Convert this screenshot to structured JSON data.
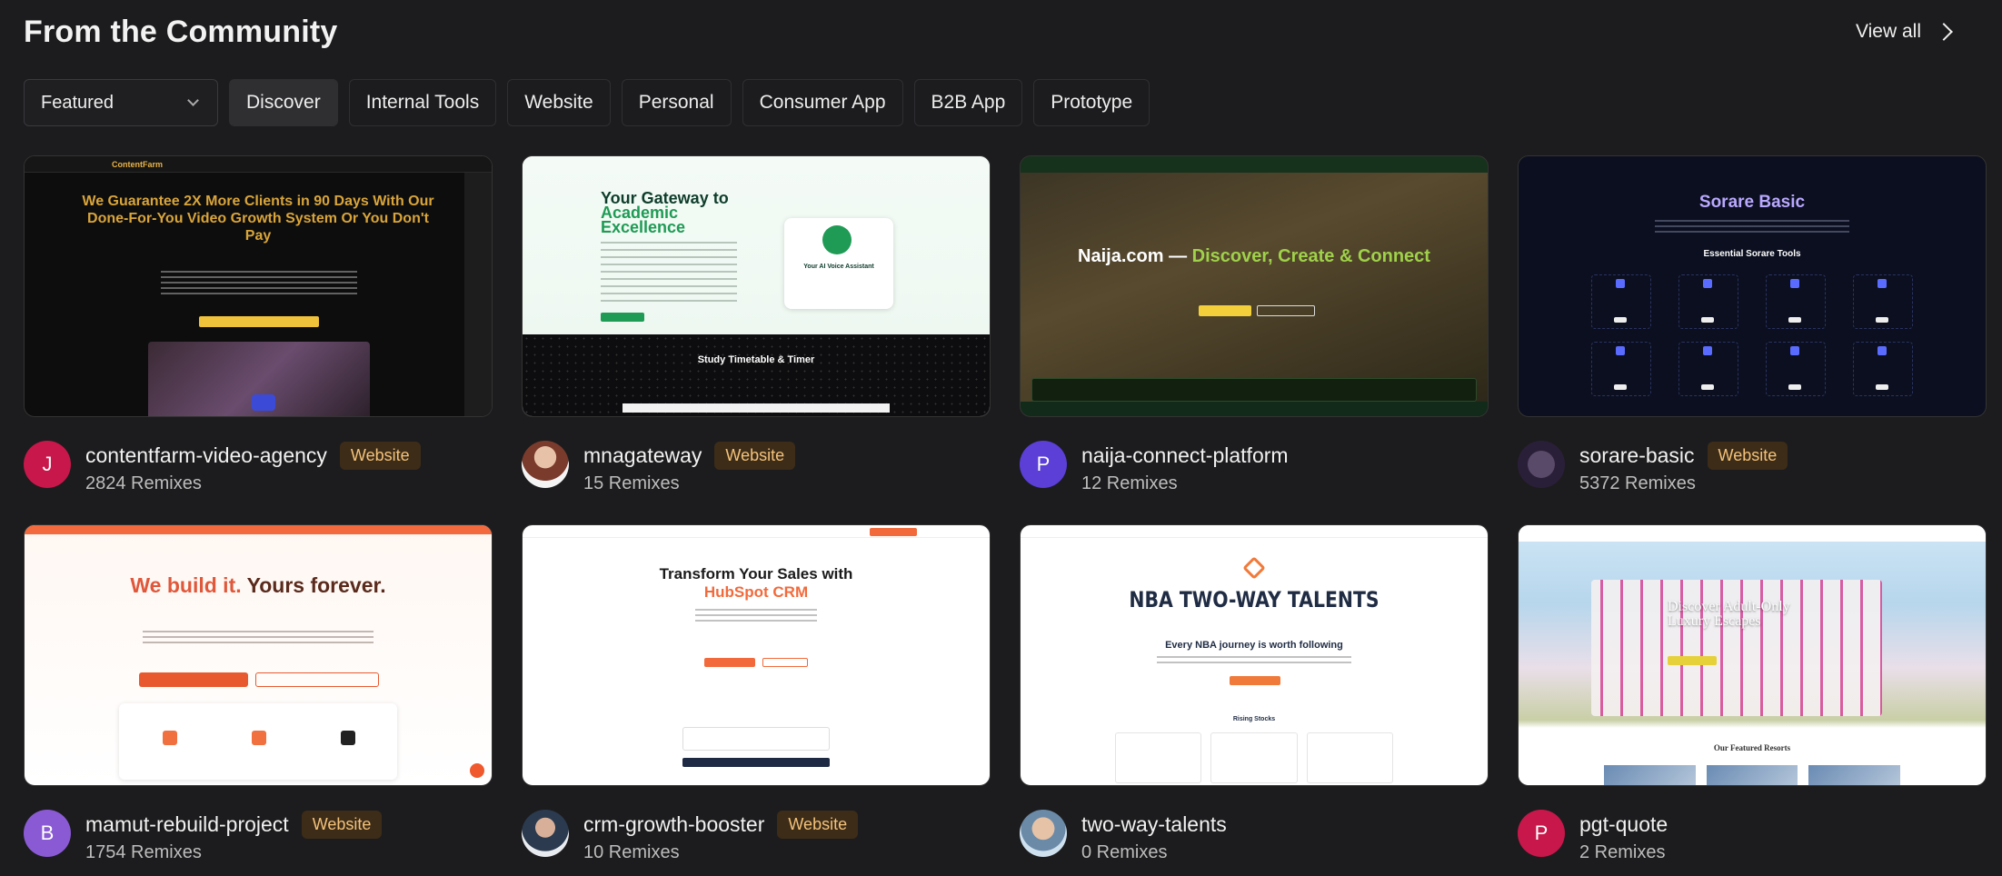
{
  "header": {
    "title": "From the Community",
    "view_all": "View all"
  },
  "filters": {
    "select_value": "Featured",
    "pills": [
      "Discover",
      "Internal Tools",
      "Website",
      "Personal",
      "Consumer App",
      "B2B App",
      "Prototype"
    ],
    "active": "Discover"
  },
  "colors": {
    "background": "#1c1c1e",
    "badge_bg": "#3d2c18",
    "badge_text": "#f3c27a"
  },
  "cards": [
    {
      "name": "contentfarm-video-agency",
      "badge": "Website",
      "remixes": "2824 Remixes",
      "avatar_letter": "J",
      "avatar_color": "#c8174a",
      "thumb": {
        "logo": "ContentFarm",
        "headline": "We Guarantee 2X More Clients in 90 Days With Our Done-For-You Video Growth System Or You Don't Pay"
      }
    },
    {
      "name": "mnagateway",
      "badge": "Website",
      "remixes": "15 Remixes",
      "avatar_letter": "",
      "avatar_color": "#7a3b2c",
      "thumb": {
        "headline_a": "Your Gateway to",
        "headline_b": "Academic Excellence",
        "card_title": "Your AI Voice Assistant",
        "dark_title": "Study Timetable & Timer"
      }
    },
    {
      "name": "naija-connect-platform",
      "badge": "",
      "remixes": "12 Remixes",
      "avatar_letter": "P",
      "avatar_color": "#5b3fd6",
      "thumb": {
        "headline_a": "Naija.com — ",
        "headline_b": "Discover, Create & Connect"
      }
    },
    {
      "name": "sorare-basic",
      "badge": "Website",
      "remixes": "5372 Remixes",
      "avatar_letter": "",
      "avatar_color": "#3a2a4a",
      "thumb": {
        "headline": "Sorare Basic",
        "section": "Essential Sorare Tools"
      }
    },
    {
      "name": "mamut-rebuild-project",
      "badge": "Website",
      "remixes": "1754 Remixes",
      "avatar_letter": "B",
      "avatar_color": "#8a5ad4",
      "thumb": {
        "headline_a": "We build it. ",
        "headline_b": "Yours forever."
      }
    },
    {
      "name": "crm-growth-booster",
      "badge": "Website",
      "remixes": "10 Remixes",
      "avatar_letter": "",
      "avatar_color": "#3b4a5a",
      "thumb": {
        "headline_a": "Transform Your Sales with",
        "headline_b": "HubSpot CRM"
      }
    },
    {
      "name": "two-way-talents",
      "badge": "",
      "remixes": "0 Remixes",
      "avatar_letter": "",
      "avatar_color": "#6b8aa8",
      "thumb": {
        "headline": "NBA TWO-WAY TALENTS",
        "sub": "Every NBA journey is worth following",
        "section": "Rising Stocks"
      }
    },
    {
      "name": "pgt-quote",
      "badge": "",
      "remixes": "2 Remixes",
      "avatar_letter": "P",
      "avatar_color": "#c8174a",
      "thumb": {
        "headline": "Discover Adult-Only Luxury Escapes",
        "section": "Our Featured Resorts"
      }
    }
  ]
}
